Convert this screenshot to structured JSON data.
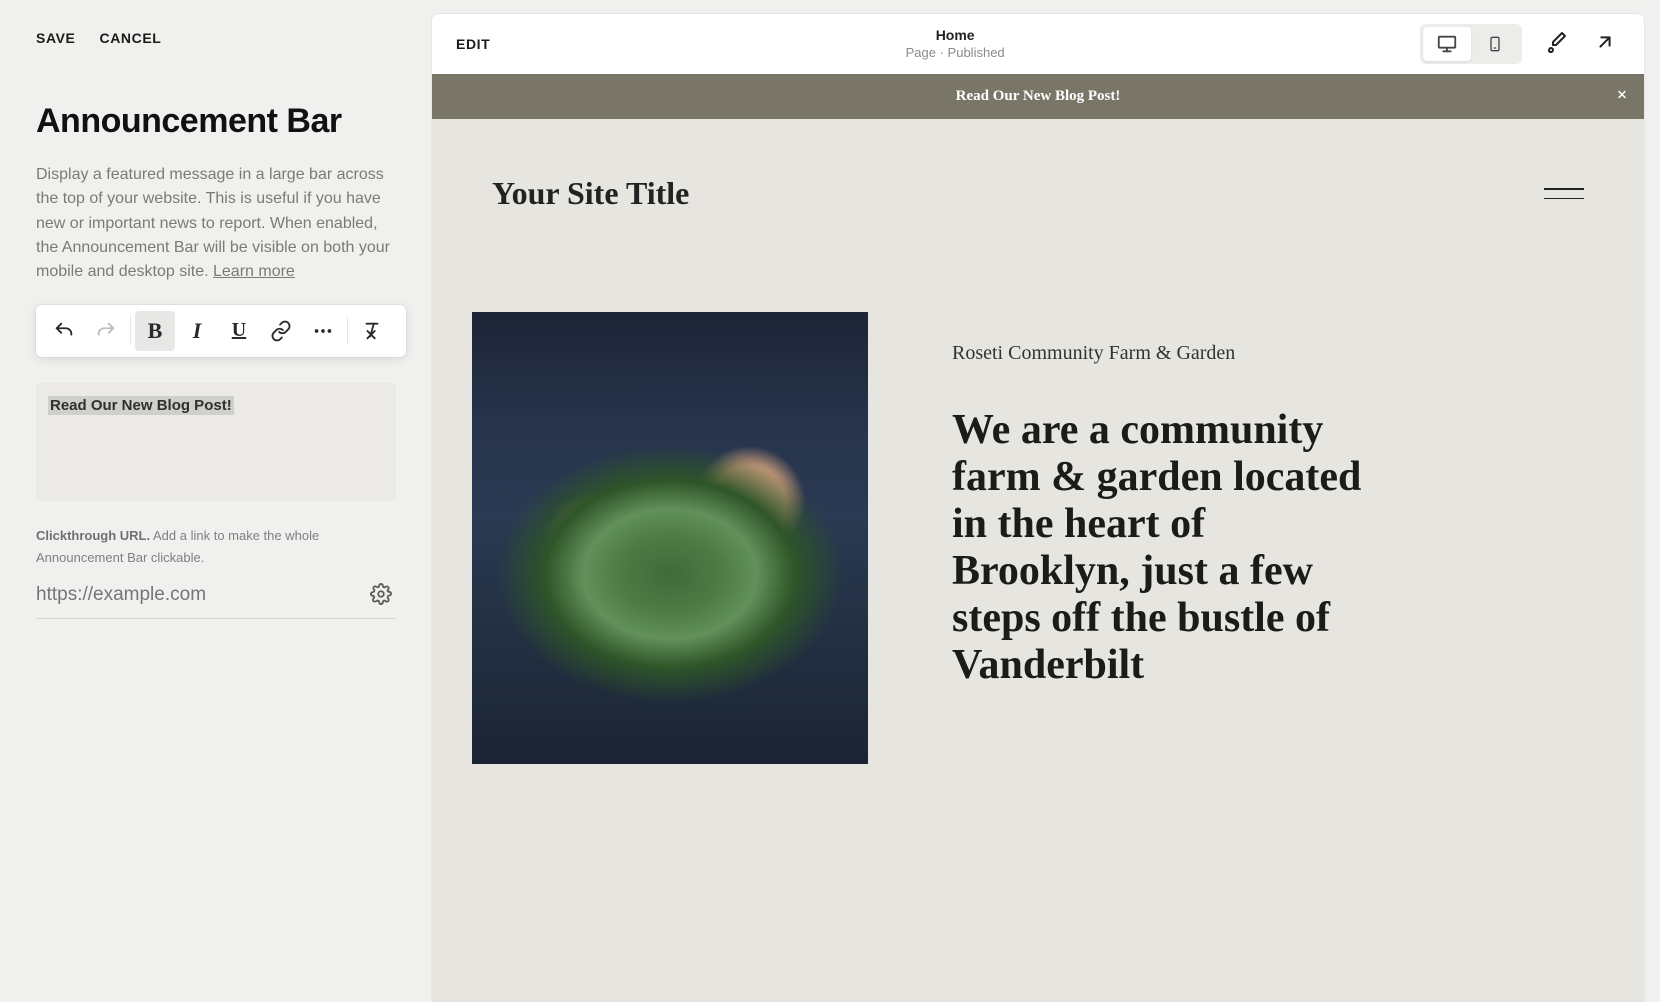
{
  "sidebar": {
    "save_label": "SAVE",
    "cancel_label": "CANCEL",
    "panel_title": "Announcement Bar",
    "description_text": "Display a featured message in a large bar across the top of your website. This is useful if you have new or important news to report. When enabled, the Announcement Bar will be visible on both your mobile and desktop site. ",
    "learn_more_label": "Learn more",
    "editor_text": "Read Our New Blog Post!",
    "url_label_bold": "Clickthrough URL.",
    "url_label_rest": " Add a link to make the whole Announcement Bar clickable.",
    "url_placeholder": "https://example.com",
    "url_value": ""
  },
  "toolbar": {
    "undo": "undo-icon",
    "redo": "redo-icon",
    "bold": "B",
    "italic": "I",
    "underline": "U",
    "link": "link-icon",
    "more": "more-icon",
    "clear": "clear-format-icon"
  },
  "preview_top": {
    "edit_label": "EDIT",
    "page_name": "Home",
    "page_status": "Page · Published"
  },
  "site": {
    "announcement_text": "Read Our New Blog Post!",
    "site_title": "Your Site Title",
    "subhead": "Roseti Community Farm & Garden",
    "hero": "We are a community farm & garden located in the heart of Brooklyn, just a few steps off the bustle of Vanderbilt"
  },
  "colors": {
    "announcement_bg": "#7a7667",
    "site_bg": "#e7e5df"
  }
}
